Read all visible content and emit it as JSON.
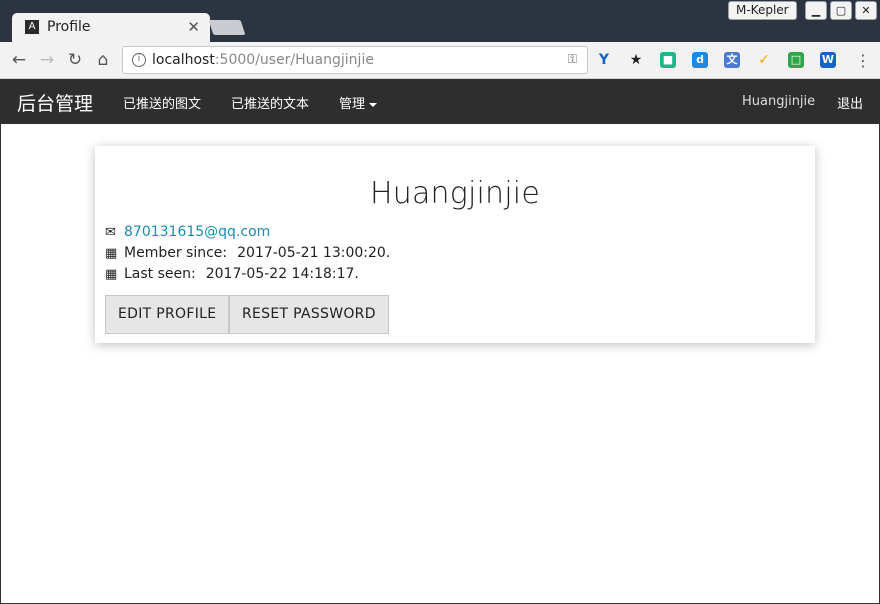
{
  "browser": {
    "tab_title": "Profile",
    "tab_favicon_letter": "A",
    "window_user": "M-Kepler",
    "url_host": "localhost",
    "url_rest": ":5000/user/Huangjinjie"
  },
  "navbar": {
    "brand": "后台管理",
    "links": [
      "已推送的图文",
      "已推送的文本",
      "管理"
    ],
    "username": "Huangjinjie",
    "logout": "退出"
  },
  "profile": {
    "name": "Huangjinjie",
    "email": "870131615@qq.com",
    "member_since_label": "Member since:",
    "member_since_value": "2017-05-21 13:00:20.",
    "last_seen_label": "Last seen:",
    "last_seen_value": "2017-05-22 14:18:17."
  },
  "buttons": {
    "edit_profile": "EDIT PROFILE",
    "reset_password": "RESET PASSWORD"
  },
  "colors": {
    "navbar_bg": "#2e2e2e",
    "link": "#1a8cb5",
    "titlebar_bg": "#2b3440"
  }
}
